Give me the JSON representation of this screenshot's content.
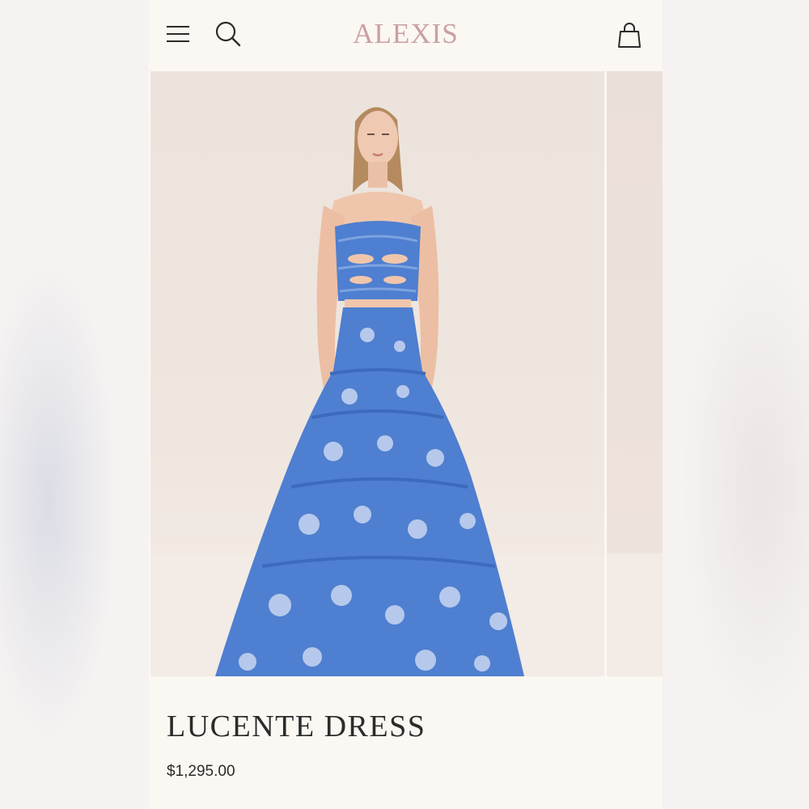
{
  "header": {
    "brand": "ALEXIS",
    "icons": [
      "menu-icon",
      "search-icon",
      "shopping-bag-icon"
    ]
  },
  "product": {
    "name": "LUCENTE DRESS",
    "price": "$1,295.00"
  },
  "colors": {
    "page_background": "#fbf7f2",
    "brand": "#c9a0a2",
    "text": "#2b2b2b",
    "dress_blue": "#4f7fd0"
  }
}
